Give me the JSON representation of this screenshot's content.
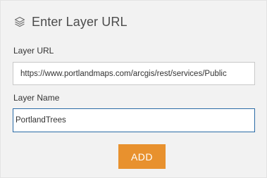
{
  "header": {
    "icon": "layers-icon",
    "title": "Enter Layer URL"
  },
  "form": {
    "layer_url": {
      "label": "Layer URL",
      "value": "https://www.portlandmaps.com/arcgis/rest/services/Public"
    },
    "layer_name": {
      "label": "Layer Name",
      "value": "PortlandTrees"
    },
    "add_button_label": "ADD"
  },
  "colors": {
    "panel_background": "#f2f2f2",
    "button_background": "#e8912e",
    "focused_input_border": "#2a6aa6"
  }
}
